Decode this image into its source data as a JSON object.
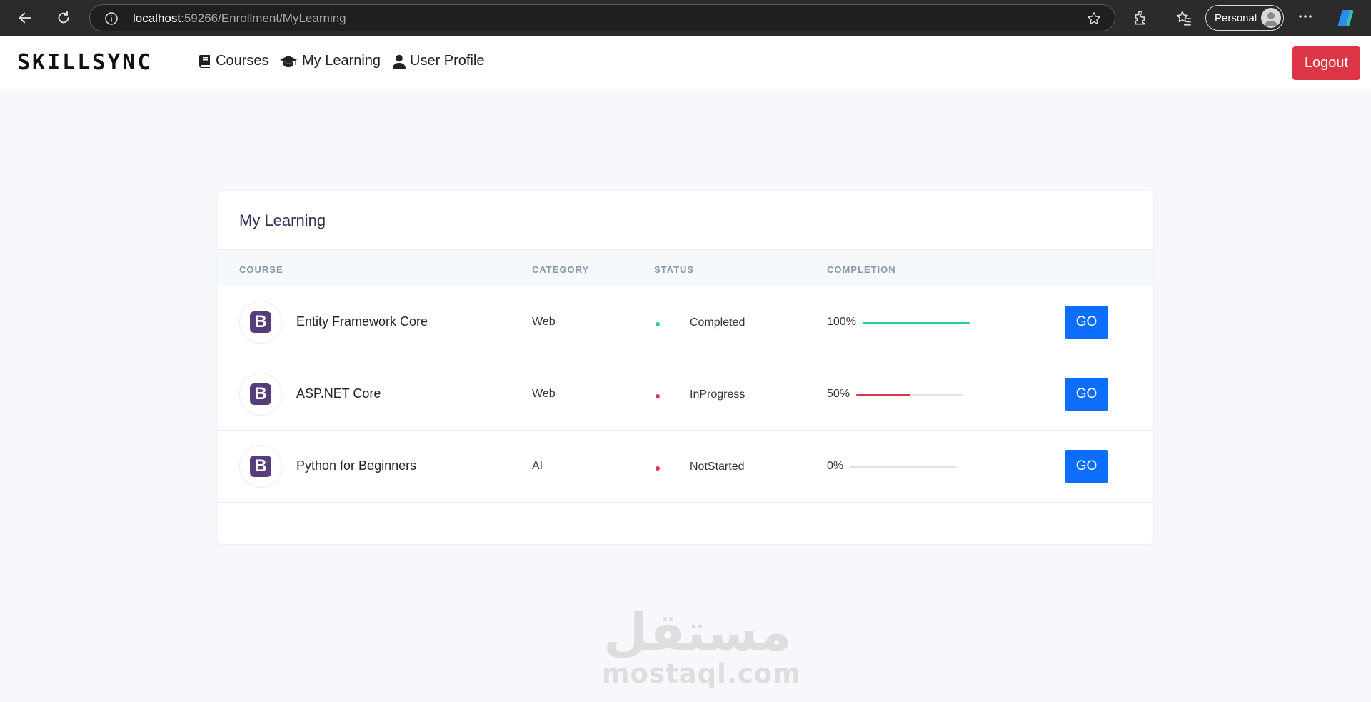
{
  "browser": {
    "url_host": "localhost",
    "url_path": ":59266/Enrollment/MyLearning",
    "profile_label": "Personal"
  },
  "nav": {
    "brand": "SKILLSYNC",
    "links": [
      {
        "label": "Courses",
        "icon": "book-icon"
      },
      {
        "label": "My Learning",
        "icon": "graduation-cap-icon"
      },
      {
        "label": "User Profile",
        "icon": "user-icon"
      }
    ],
    "logout_label": "Logout"
  },
  "card": {
    "title": "My Learning",
    "columns": [
      "COURSE",
      "CATEGORY",
      "STATUS",
      "COMPLETION"
    ],
    "rows": [
      {
        "logo": "B",
        "course": "Entity Framework Core",
        "category": "Web",
        "status": "Completed",
        "completion": "100%",
        "progress": 1.0,
        "status_color": "#2dce89",
        "bar_color": "#2dce89",
        "action": "GO"
      },
      {
        "logo": "B",
        "course": "ASP.NET Core",
        "category": "Web",
        "status": "InProgress",
        "completion": "50%",
        "progress": 0.5,
        "status_color": "#dc3545",
        "bar_color": "#dc3545",
        "action": "GO"
      },
      {
        "logo": "B",
        "course": "Python for Beginners",
        "category": "AI",
        "status": "NotStarted",
        "completion": "0%",
        "progress": 0.0,
        "status_color": "#dc3545",
        "bar_color": "#dc3545",
        "action": "GO"
      }
    ]
  },
  "watermark": {
    "arabic": "مستقل",
    "latin": "mostaql.com"
  },
  "colors": {
    "logout_red": "#dc3545",
    "go_blue": "#0d6efd",
    "bootstrap_purple": "#563d7c"
  }
}
